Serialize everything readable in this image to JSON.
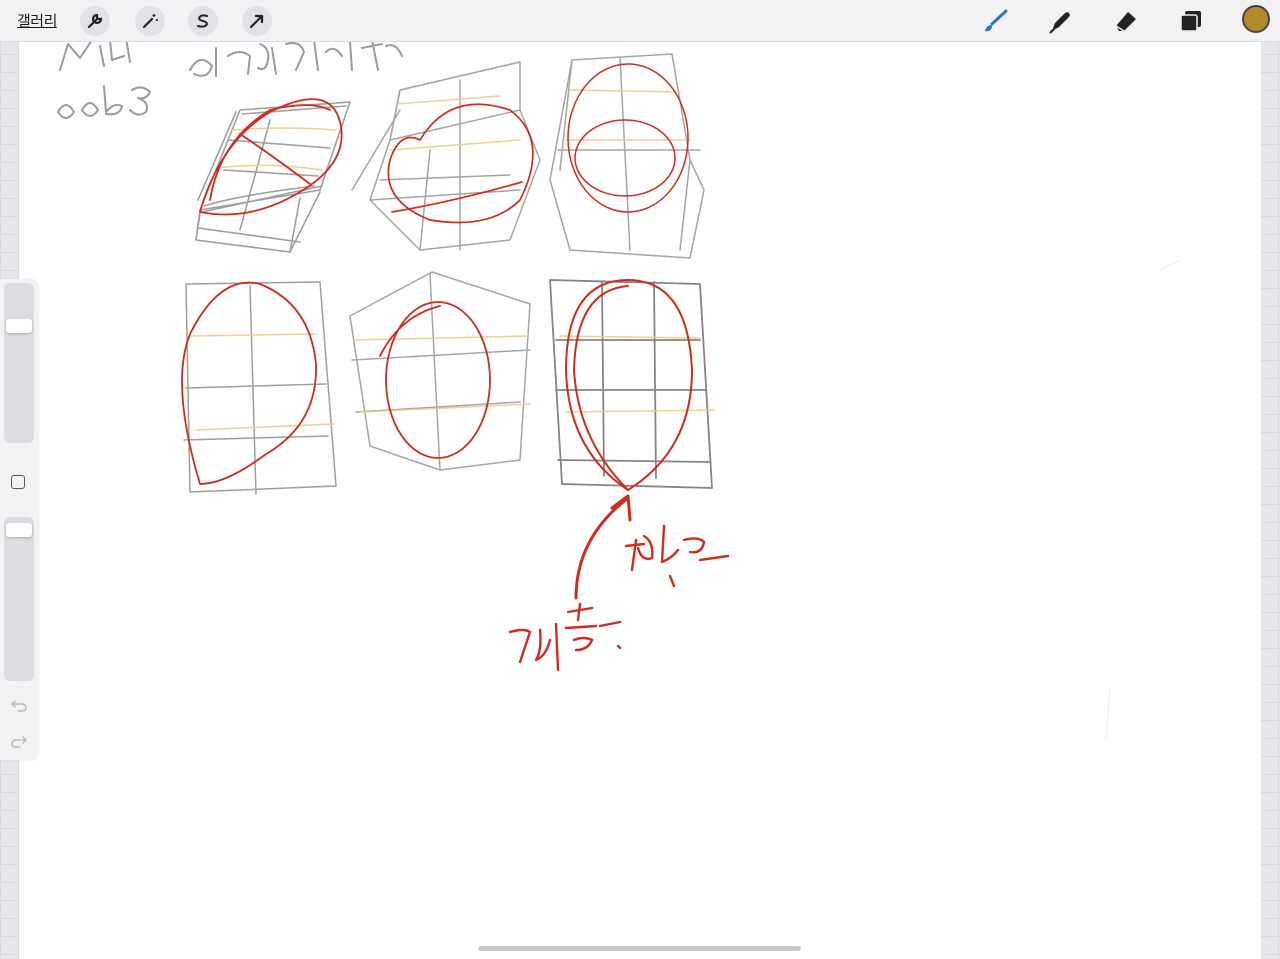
{
  "app": {
    "gallery_label": "갤러리"
  },
  "toolbar_left": {
    "icons": [
      "wrench-icon",
      "magic-wand-icon",
      "selection-s-icon",
      "transform-arrow-icon"
    ]
  },
  "toolbar_right": {
    "icons": [
      "brush-icon",
      "smudge-icon",
      "eraser-icon",
      "layers-icon"
    ],
    "active_tool": "brush-icon",
    "brush_color": "#2f6fd6",
    "current_color": "#b38a2a"
  },
  "sidebar": {
    "brush_size_level": 0.9,
    "opacity_level": 0.95,
    "icons": [
      "modify-square-icon",
      "undo-icon",
      "redo-icon"
    ]
  },
  "colors": {
    "pencil": "#8e8e8e",
    "red_pencil": "#d22a1e",
    "yellow_pencil": "#ecc98a"
  }
}
